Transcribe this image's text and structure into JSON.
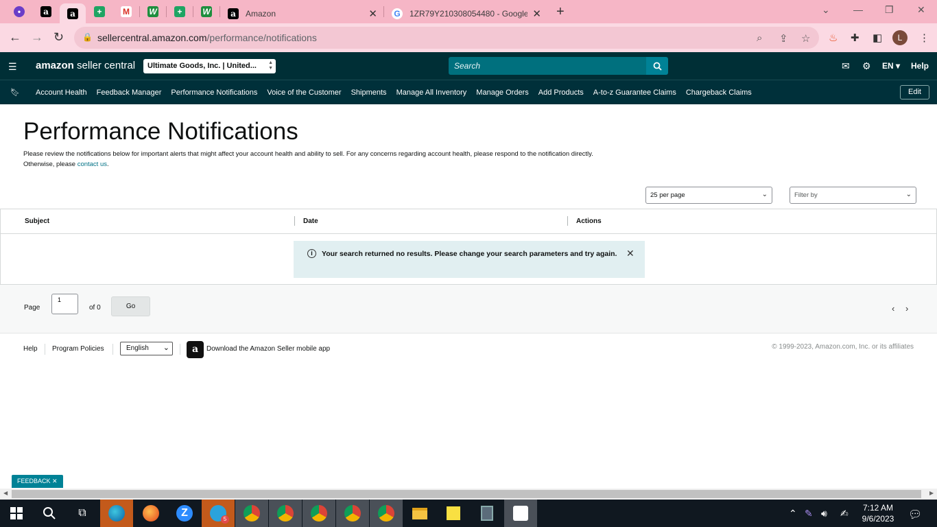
{
  "browser": {
    "tabs": [
      {
        "title": "Amazon"
      },
      {
        "title": "1ZR79Y210308054480 - Google"
      }
    ],
    "url_domain": "sellercentral.amazon.com",
    "url_path": "/performance/notifications",
    "profile_initial": "L"
  },
  "header": {
    "logo_amazon": "amazon",
    "logo_rest": " seller central",
    "store": "Ultimate Goods, Inc. | United...",
    "search_placeholder": "Search",
    "lang": "EN",
    "help": "Help"
  },
  "nav": {
    "items": [
      "Account Health",
      "Feedback Manager",
      "Performance Notifications",
      "Voice of the Customer",
      "Shipments",
      "Manage All Inventory",
      "Manage Orders",
      "Add Products",
      "A-to-z Guarantee Claims",
      "Chargeback Claims"
    ],
    "edit": "Edit"
  },
  "page": {
    "title": "Performance Notifications",
    "intro": "Please review the notifications below for important alerts that might affect your account health and ability to sell. For any concerns regarding account health, please respond to the notification directly. Otherwise, please ",
    "contact_link": "contact us",
    "intro_end": ".",
    "per_page": "25 per page",
    "filter_placeholder": "Filter by"
  },
  "table": {
    "columns": [
      "Subject",
      "Date",
      "Actions"
    ],
    "alert": "Your search returned no results. Please change your search parameters and try again."
  },
  "pager": {
    "page_label": "Page",
    "page_value": "1",
    "of_label": "of 0",
    "go": "Go"
  },
  "footer": {
    "help": "Help",
    "policies": "Program Policies",
    "language": "English",
    "app_text": "Download the Amazon Seller mobile app",
    "copyright": "© 1999-2023, Amazon.com, Inc. or its affiliates"
  },
  "feedback": "FEEDBACK",
  "taskbar": {
    "time": "7:12 AM",
    "date": "9/6/2023",
    "telegram_badge": "5"
  }
}
